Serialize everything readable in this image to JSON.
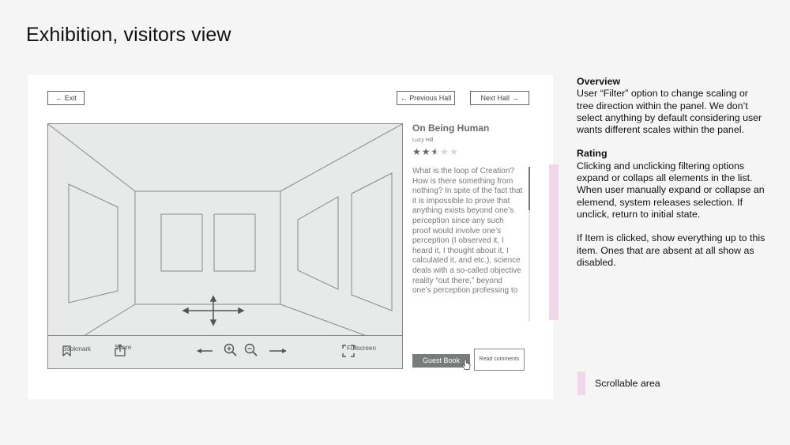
{
  "page": {
    "title": "Exhibition, visitors view"
  },
  "nav": {
    "exit_label": "← Exit",
    "previous_label": "← Previous Hall",
    "next_label": "Next Hall →"
  },
  "viewer_toolbar": {
    "bookmark_label": "Bookmark",
    "share_label": "Share",
    "fullscreen_label": "Fullscreen",
    "icons": [
      "bookmark-icon",
      "share-icon",
      "arrow-left-icon",
      "zoom-in-icon",
      "zoom-out-icon",
      "arrow-right-icon",
      "fullscreen-icon"
    ]
  },
  "artwork": {
    "title": "On Being Human",
    "author": "Lucy Hill",
    "rating": 2.5,
    "rating_max": 5,
    "description": "What is the loop of Creation? How is there something from nothing? In spite of the fact that it is impossible to prove that anything exists beyond one’s perception since any such proof would involve one’s perception (I observed it, I heard it, I thought about it, I calculated it, and etc.), science deals with a so-called objective reality “out there,” beyond one’s perception professing to"
  },
  "actions": {
    "guest_book_label": "Guest Book",
    "read_comments_label": "Read comments"
  },
  "notes": {
    "overview_heading": "Overview",
    "overview_text": "User “Filter” option to change scaling or tree direction within the panel. We don’t select anything by default considering user wants different scales within the panel.",
    "rating_heading": "Rating",
    "rating_text": "Clicking and unclicking filtering options expand or collaps all elements in the list. When user manually expand or collapse an elemend, system releases selection. If unclick, return to initial state.",
    "item_text": "If Item is clicked, show everything up to this item. Ones that are absent at all show as disabled."
  },
  "legend": {
    "scrollable_label": "Scrollable area",
    "scrollable_color": "#f2d6ea"
  },
  "colors": {
    "wireframe_fill": "#e8eae9",
    "wireframe_stroke": "#888888",
    "button_dark": "#787c7a"
  }
}
